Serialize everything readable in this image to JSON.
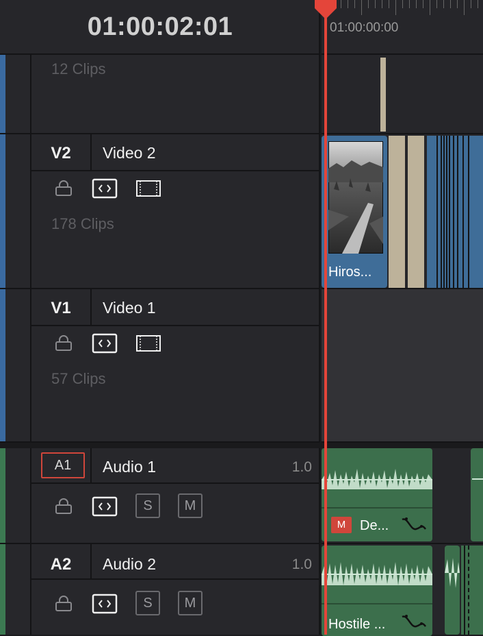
{
  "header": {
    "timecode": "01:00:02:01",
    "ruler_time": "01:00:00:00"
  },
  "tracks": {
    "v3": {
      "clips": "12 Clips"
    },
    "v2": {
      "id": "V2",
      "name": "Video 2",
      "clips": "178 Clips"
    },
    "v1": {
      "id": "V1",
      "name": "Video 1",
      "clips": "57 Clips"
    },
    "a1": {
      "id": "A1",
      "name": "Audio 1",
      "volume": "1.0",
      "solo": "S",
      "mute": "M"
    },
    "a2": {
      "id": "A2",
      "name": "Audio 2",
      "volume": "1.0",
      "solo": "S",
      "mute": "M"
    }
  },
  "timeline": {
    "v2_clip_label": "Hiros...",
    "a1_clip_label": "De...",
    "a1_clip_badge": "M",
    "a2_clip_label": "Hostile ..."
  },
  "colors": {
    "playhead": "#e4453a",
    "video_clip": "#3f6d98",
    "audio_clip": "#3c6f4c",
    "mute_badge": "#d0463b"
  }
}
